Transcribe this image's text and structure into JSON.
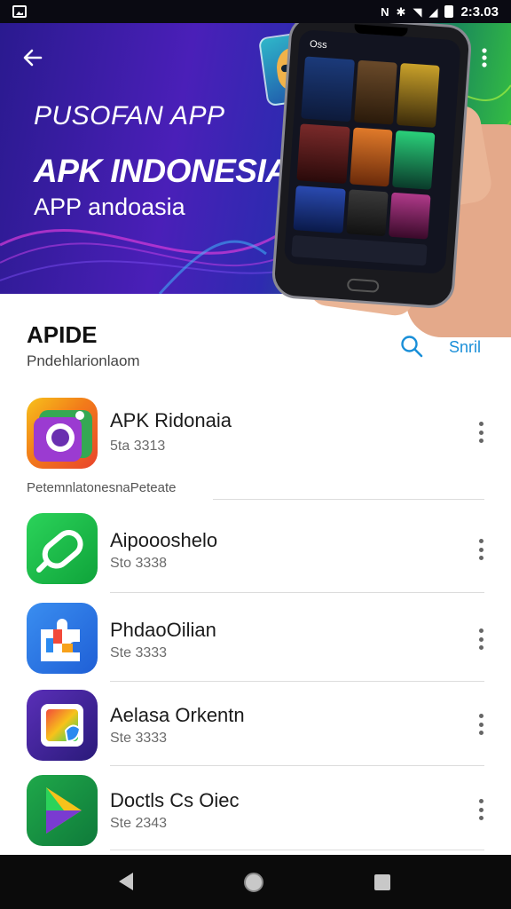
{
  "status_bar": {
    "time": "2:3.03",
    "icons": [
      "image-icon",
      "nfc-icon",
      "bluetooth-icon",
      "wifi-icon",
      "signal-icon",
      "battery-icon"
    ]
  },
  "hero": {
    "title_line1": "PUSOFAN APP",
    "title_line2": "APK INDONESIA",
    "title_line3": "APP andoasia",
    "phone_label": "Oss",
    "colors": {
      "gradient_start": "#2a1a8f",
      "gradient_end": "#3ed13a"
    }
  },
  "section": {
    "title": "APIDE",
    "subtitle": "Pndehlarionlaom",
    "action_label": "Snril"
  },
  "category_label": "PetemnlatonesnaPeteate",
  "apps": [
    {
      "name": "APK Ridonaia",
      "meta": "5ta 3313",
      "icon": "camera-app-icon"
    },
    {
      "name": "Aipoooshelo",
      "meta": "Sto 3338",
      "icon": "link-app-icon"
    },
    {
      "name": "PhdaoOilian",
      "meta": "Ste 3333",
      "icon": "puzzle-app-icon"
    },
    {
      "name": "Aelasa Orkentn",
      "meta": "Ste 3333",
      "icon": "gallery-app-icon"
    },
    {
      "name": "Doctls Cs Oiec",
      "meta": "Ste 2343",
      "icon": "play-app-icon"
    }
  ],
  "accent_color": "#1a8fd8"
}
